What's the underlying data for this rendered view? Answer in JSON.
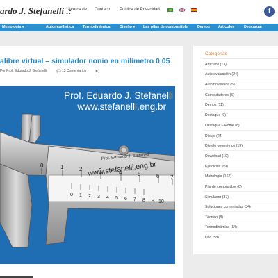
{
  "header": {
    "logo": "ardo J. Stefanelli .:",
    "top_links": [
      "Acerca de",
      "Contacto",
      "Política de Privacidad"
    ],
    "facebook_glyph": "f",
    "flags": [
      "brazil-flag-icon",
      "uk-flag-icon",
      "spain-flag-icon"
    ],
    "facebook_color": "#3b5998"
  },
  "nav": {
    "items": [
      "Metrología ▾",
      "Automovilística",
      "Termodinámica",
      "Diseño ▾",
      "Las pilas de combustible",
      "Demos",
      "Artículos",
      "Descargar"
    ],
    "color": "#2c8fcf"
  },
  "post": {
    "title": "alibre virtual – simulador nonio en milímetro 0,05",
    "author": "Por Prof. Eduardo J. Stefanelli",
    "comments": "13 Comentarios",
    "image": {
      "caption_line1": "Prof. Eduardo J. Stefanelli",
      "caption_line2": "www.stefanelli.eng.br",
      "body_text1": "Prof. Eduardo J. Stefanelli",
      "body_text2": "www.stefanelli.eng.br",
      "main_scale": [
        "0",
        "1",
        "2",
        "3",
        "4",
        "5",
        "6",
        "7"
      ],
      "vernier_scale": [
        "0",
        "1",
        "2",
        "3",
        "4",
        "5",
        "6",
        "7",
        "8",
        "9",
        "10"
      ],
      "background": "#1f6db3"
    }
  },
  "sidebar": {
    "title": "Categorías",
    "categories": [
      "Artículos (13)",
      "Auto evaluación (24)",
      "Automovilística (5)",
      "Computadores (5)",
      "Demos (11)",
      "Destaque (9)",
      "Destaque – Home (8)",
      "Dibujo (24)",
      "Diseño geométrico (19)",
      "Download (10)",
      "Ejercicios (69)",
      "Metrología (162)",
      "Pila de combustible (8)",
      "Simulador (37)",
      "Soluciones comentadas (34)",
      "Técnico (8)",
      "Termodinámica (14)",
      "Uso (58)"
    ],
    "title_color": "#d9823b"
  }
}
